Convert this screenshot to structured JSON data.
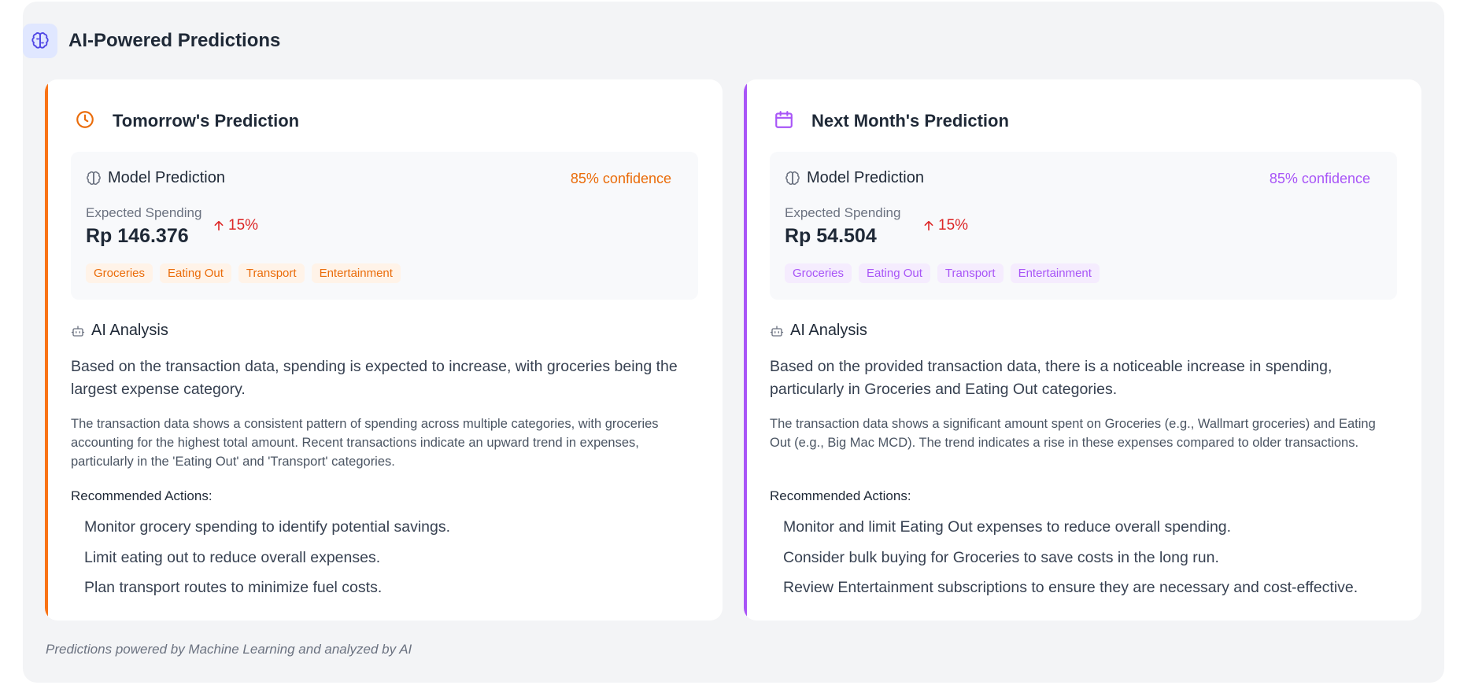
{
  "header": {
    "title": "AI-Powered Predictions",
    "icon": "brain-icon",
    "accent": "#4f46e5"
  },
  "cards": [
    {
      "title": "Tomorrow's Prediction",
      "icon": "clock-icon",
      "accent": "#f97316",
      "accent_text": "#ea6c0a",
      "tag_bg": "#fff3e8",
      "model_label": "Model Prediction",
      "confidence": "85% confidence",
      "expected_label": "Expected Spending",
      "amount": "Rp 146.376",
      "change": "15%",
      "tags": [
        "Groceries",
        "Eating Out",
        "Transport",
        "Entertainment"
      ],
      "analysis_title": "AI Analysis",
      "summary": "Based on the transaction data, spending is expected to increase, with groceries being the largest expense category.",
      "detail": "The transaction data shows a consistent pattern of spending across multiple categories, with groceries accounting for the highest total amount. Recent transactions indicate an upward trend in expenses, particularly in the 'Eating Out' and 'Transport' categories.",
      "rec_title": "Recommended Actions:",
      "recommendations": [
        "Monitor grocery spending to identify potential savings.",
        "Limit eating out to reduce overall expenses.",
        "Plan transport routes to minimize fuel costs."
      ]
    },
    {
      "title": "Next Month's Prediction",
      "icon": "calendar-icon",
      "accent": "#a855f7",
      "accent_text": "#a855f7",
      "tag_bg": "#f5ecfe",
      "model_label": "Model Prediction",
      "confidence": "85% confidence",
      "expected_label": "Expected Spending",
      "amount": "Rp 54.504",
      "change": "15%",
      "tags": [
        "Groceries",
        "Eating Out",
        "Transport",
        "Entertainment"
      ],
      "analysis_title": "AI Analysis",
      "summary": "Based on the provided transaction data, there is a noticeable increase in spending, particularly in Groceries and Eating Out categories.",
      "detail": "The transaction data shows a significant amount spent on Groceries (e.g., Wallmart groceries) and Eating Out (e.g., Big Mac MCD). The trend indicates a rise in these expenses compared to older transactions.",
      "rec_title": "Recommended Actions:",
      "recommendations": [
        "Monitor and limit Eating Out expenses to reduce overall spending.",
        "Consider bulk buying for Groceries to save costs in the long run.",
        "Review Entertainment subscriptions to ensure they are necessary and cost-effective."
      ]
    }
  ],
  "footer": "Predictions powered by Machine Learning and analyzed by AI"
}
